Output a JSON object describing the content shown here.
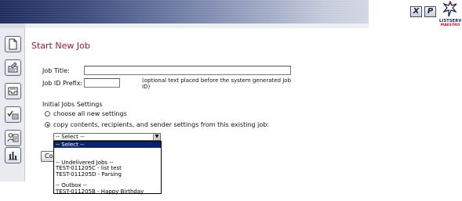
{
  "header": {
    "close_label": "X",
    "print_label": "P",
    "logo_word1": "LISTSERV",
    "logo_word2": "MAESTRO"
  },
  "sidebar": {
    "items": [
      {
        "icon": "new-page-icon"
      },
      {
        "icon": "edit-list-icon"
      },
      {
        "icon": "outbox-tray-icon"
      },
      {
        "icon": "checklist-icon"
      },
      {
        "icon": "users-icon"
      },
      {
        "icon": "bar-chart-icon"
      }
    ]
  },
  "page": {
    "title": "Start New Job"
  },
  "form": {
    "job_title_label": "Job Title:",
    "job_title_value": "",
    "job_prefix_label": "Job ID Prefix:",
    "job_prefix_value": "",
    "prefix_hint": "(optional text placed before the system generated Job ID)",
    "settings_heading": "Initial Jobs Settings",
    "radio_new_label": "choose all new settings",
    "radio_new_checked": false,
    "radio_copy_label": "copy contents, recipients, and sender settings from this existing job:",
    "radio_copy_checked": true,
    "select_value": "-- Select --",
    "button_label": "Continue"
  },
  "dropdown": {
    "options": [
      {
        "label": "-- Select --",
        "selected": true
      },
      {
        "label": "",
        "selected": false
      },
      {
        "label": "",
        "selected": false
      },
      {
        "label": "-- Undelivered Jobs --",
        "selected": false
      },
      {
        "label": "TEST-011205C - list test",
        "selected": false
      },
      {
        "label": "TEST-011205D - Parsing",
        "selected": false
      },
      {
        "label": "",
        "selected": false
      },
      {
        "label": "-- Outbox --",
        "selected": false
      },
      {
        "label": "TEST-011205B - Happy Birthday",
        "selected": false
      }
    ]
  },
  "colors": {
    "title_red": "#9b1a2e",
    "selection_blue": "#0a246a",
    "header_dark": "#1c2a5c"
  }
}
